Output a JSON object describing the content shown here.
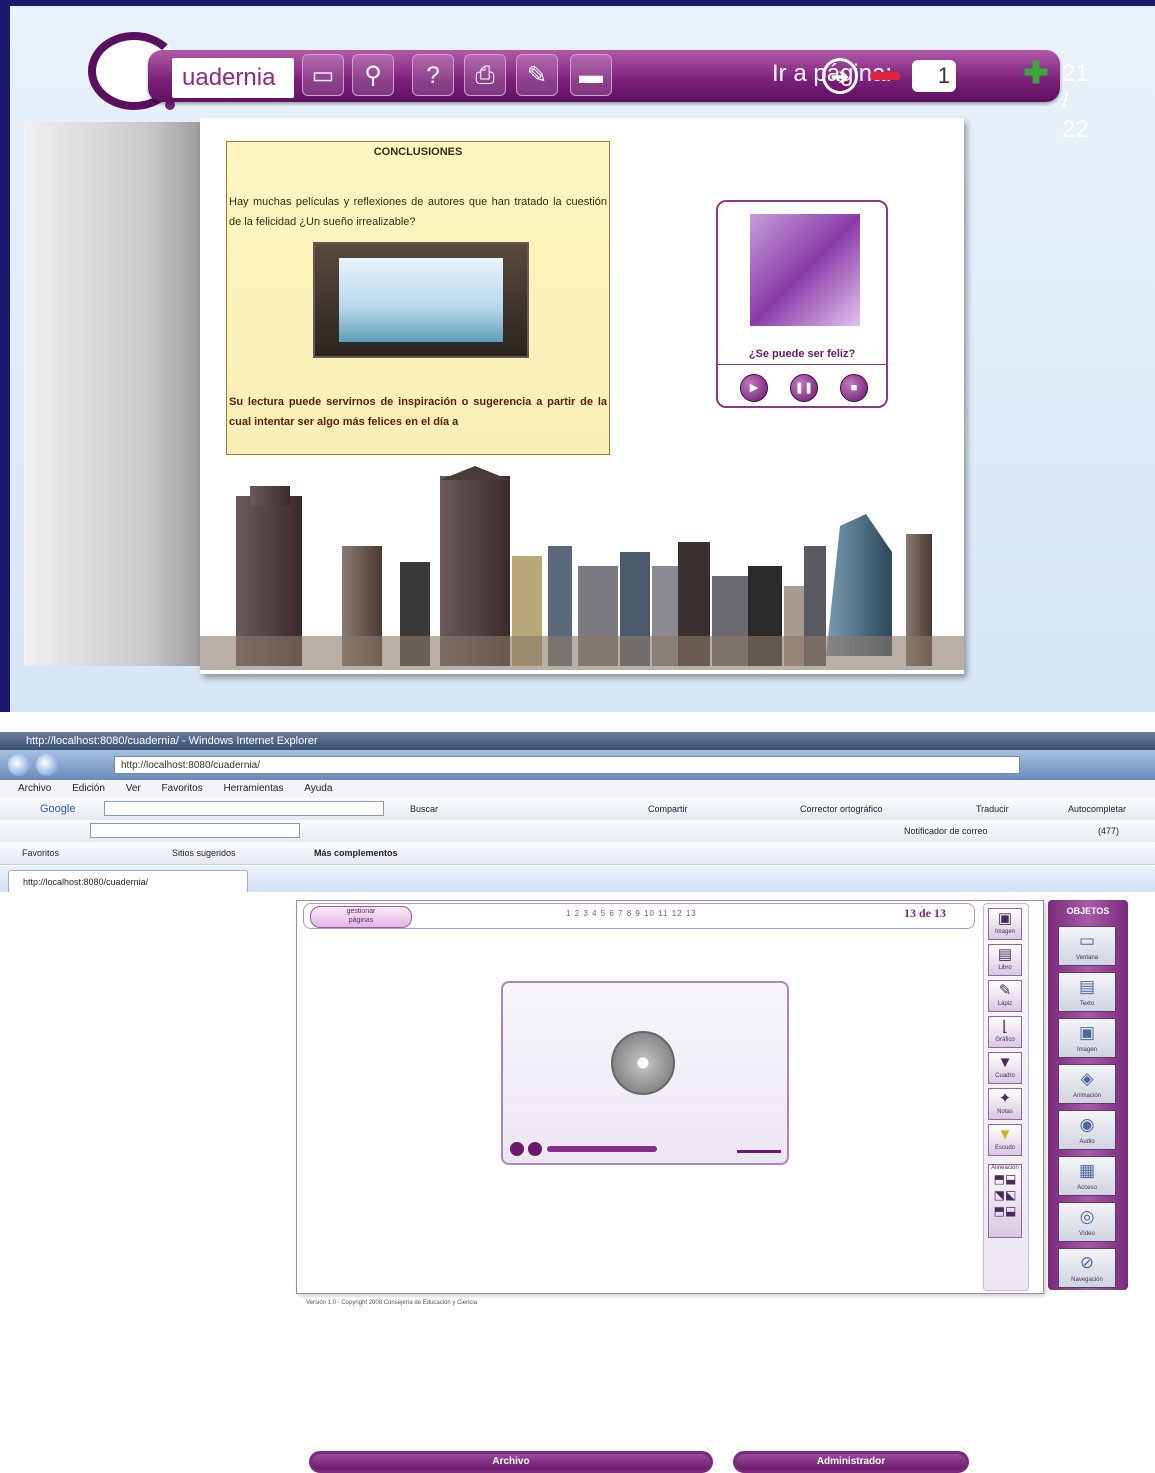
{
  "viewer": {
    "brand": "uadernia",
    "toolbar_icons": [
      "monitor-icon",
      "search-icon",
      "help-icon",
      "print-icon",
      "clean-icon",
      "book-icon"
    ],
    "goto_label": "Ir a página:",
    "page_input_value": "1",
    "page_counter": "21 / 22",
    "content": {
      "title": "CONCLUSIONES",
      "paragraph1": "Hay muchas películas y reflexiones de autores que han tratado la cuestión de la felicidad ¿Un sueño irrealizable?",
      "paragraph2": "Su lectura puede servirnos de inspiración o sugerencia a partir de la cual intentar ser algo más felices en el día a"
    },
    "media": {
      "question": "¿Se puede ser feliz?",
      "controls": [
        "play-icon",
        "pause-icon",
        "stop-icon"
      ]
    }
  },
  "browser": {
    "title": "http://localhost:8080/cuadernia/ - Windows Internet Explorer",
    "url": "http://localhost:8080/cuadernia/",
    "menu": [
      "Archivo",
      "Edición",
      "Ver",
      "Favoritos",
      "Herramientas",
      "Ayuda"
    ],
    "google_label": "Google",
    "google_items": [
      "Buscar",
      "Compartir",
      "Corrector ortográfico",
      "Traducir",
      "Autocompletar"
    ],
    "toolbar2_items": [
      "Notificador de correo",
      "(477)"
    ],
    "favorites": [
      "Favoritos",
      "Sitios sugeridos",
      "Más complementos"
    ],
    "tab_label": "http://localhost:8080/cuadernia/"
  },
  "editor": {
    "tab_label_1": "gestionar",
    "tab_label_2": "páginas",
    "page_numbers": "1 2 3 4 5 6 7 8 9 10 11 12 13",
    "page_total": "13 de 13",
    "tools": [
      "Imagen",
      "Libro",
      "Lápiz",
      "Gráfico",
      "Cuadro",
      "Notas",
      "Escudo",
      "Alineación"
    ],
    "objetos_title": "OBJETOS",
    "objetos": [
      "Ventana",
      "Texto",
      "Imagen",
      "Animación",
      "Audio",
      "Acceso",
      "Vídeo",
      "Navegación"
    ],
    "archivo_btn": "Archivo",
    "admin_btn": "Administrador",
    "footer": "Versión 1.0 - Copyright 2008 Consejería de Educación y Ciencia"
  }
}
